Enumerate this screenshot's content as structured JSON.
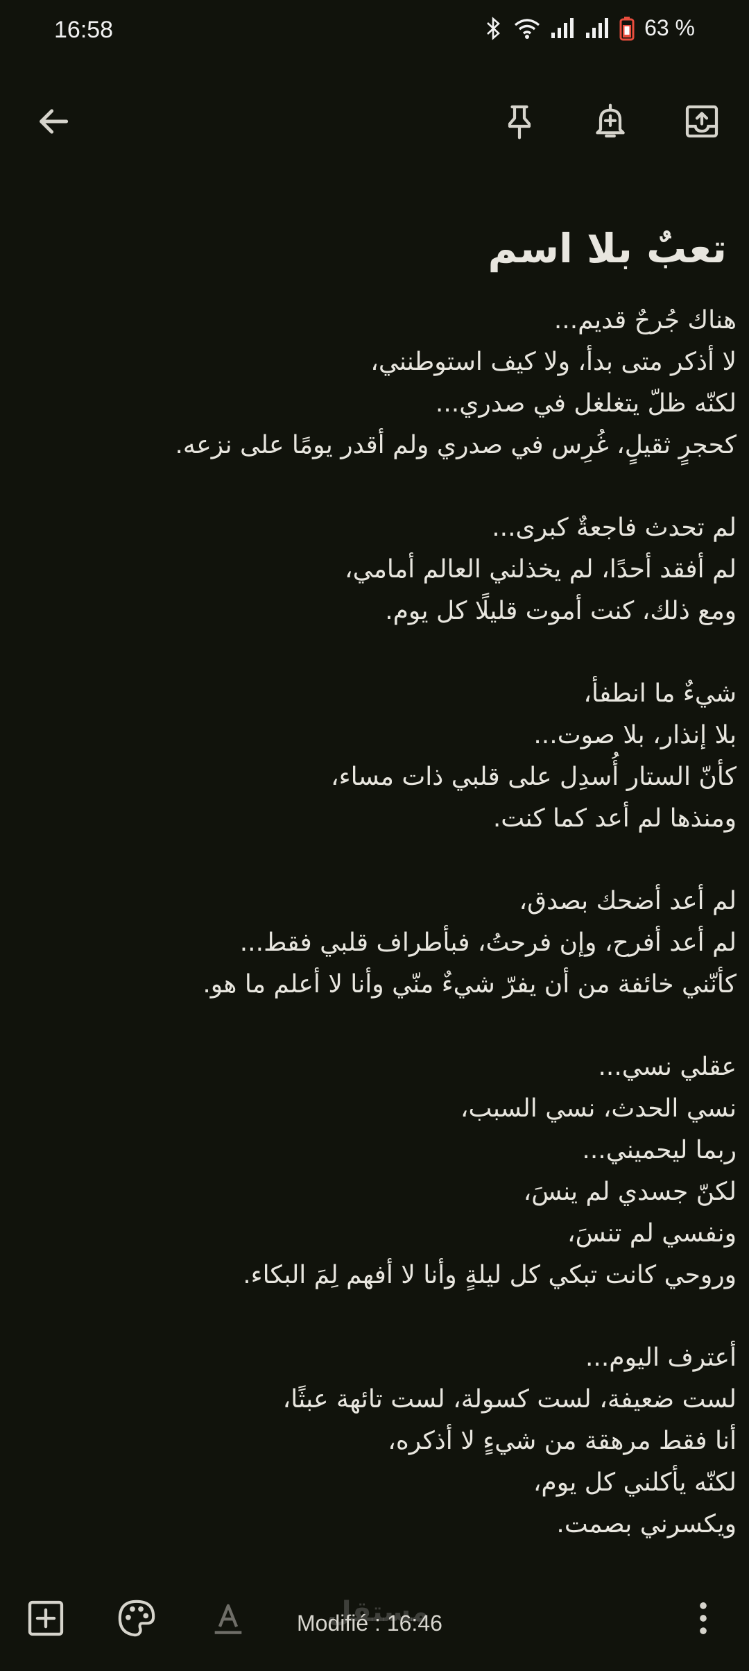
{
  "status_bar": {
    "time": "16:58",
    "battery": "63 %",
    "icons": [
      "bluetooth-icon",
      "wifi-icon",
      "signal-icon",
      "signal-icon",
      "battery-icon"
    ]
  },
  "toolbar": {
    "icons": [
      "back-arrow-icon",
      "pin-icon",
      "reminder-bell-icon",
      "archive-icon"
    ]
  },
  "note": {
    "title": "تعبٌ بلا اسم",
    "stanzas": [
      [
        "هناك جُرحٌ قديم...",
        "لا أذكر متى بدأ، ولا كيف استوطنني،",
        "لكنّه ظلّ يتغلغل في صدري...",
        "كحجرٍ ثقيلٍ، غُرِس في صدري ولم أقدر يومًا على نزعه."
      ],
      [
        "لم تحدث فاجعةٌ كبرى...",
        "لم أفقد أحدًا، لم يخذلني العالم أمامي،",
        "ومع ذلك، كنت أموت قليلًا كل يوم."
      ],
      [
        "شيءٌ ما انطفأ،",
        "بلا إنذار، بلا صوت...",
        "كأنّ الستار أُسدِل على قلبي ذات مساء،",
        "ومنذها لم أعد كما كنت."
      ],
      [
        "لم أعد أضحك بصدق،",
        "لم أعد أفرح، وإن فرحتُ، فبأطراف قلبي فقط...",
        "كأنّني خائفة من أن يفرّ شيءٌ منّي وأنا لا أعلم ما هو."
      ],
      [
        "عقلي نسي...",
        "نسي الحدث، نسي السبب،",
        "ربما ليحميني...",
        "لكنّ جسدي لم ينسَ،",
        "ونفسي لم تنسَ،",
        "وروحي كانت تبكي كل ليلةٍ وأنا لا أفهم لِمَ البكاء."
      ],
      [
        "أعترف اليوم...",
        "لست ضعيفة، لست كسولة، لست تائهة عبثًا،",
        "أنا فقط مرهقة من شيءٍ لا أذكره،",
        "لكنّه يأكلني كل يوم،",
        "ويكسرني بصمت."
      ]
    ]
  },
  "bottom_bar": {
    "modified": "Modifié : 16:46",
    "watermark": "مستقل",
    "icons": [
      "add-box-icon",
      "palette-icon",
      "text-format-icon",
      "more-vert-icon"
    ]
  },
  "colors": {
    "background": "#11130c",
    "text": "#e8e6df",
    "icon": "#d6d4cc"
  }
}
